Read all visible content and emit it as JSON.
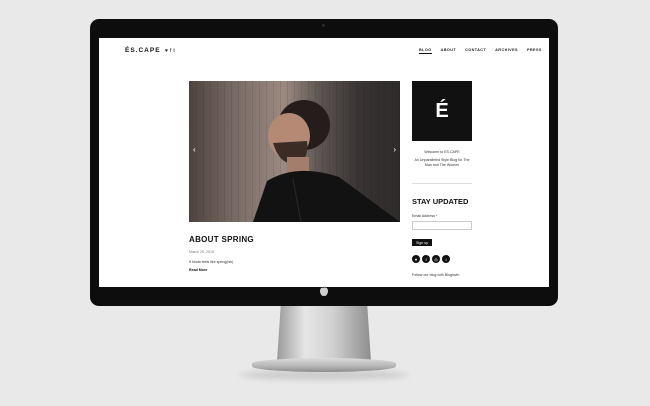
{
  "site": {
    "logo": "ÉS.CAPE",
    "social_top": [
      "♥",
      "f",
      "t"
    ],
    "nav": [
      "BLOG",
      "ABOUT",
      "CONTACT",
      "ARCHIVES",
      "PRESS"
    ]
  },
  "slider": {
    "prev": "‹",
    "next": "›"
  },
  "post": {
    "title": "ABOUT SPRING",
    "date": "March 20, 2015",
    "excerpt": "It kinda feels like spring(ish)",
    "read_more": "Read More"
  },
  "sidebar": {
    "badge_letter": "É",
    "welcome": "Welcome to ES.CAPE",
    "tagline": "An Unparalleled Style Blog for The Man and The Women",
    "newsletter_title": "STAY UPDATED",
    "email_label": "Email Address *",
    "email_value": "",
    "signup_label": "Sign up",
    "social": [
      "♥",
      "f",
      "◎",
      "t"
    ],
    "follow": "Follow our blog with Bloglovin"
  },
  "device": {
    "brand_icon": "apple-logo-icon"
  }
}
